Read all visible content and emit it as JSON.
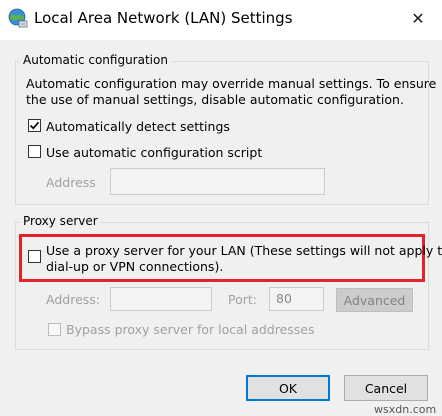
{
  "window": {
    "title": "Local Area Network (LAN) Settings",
    "close_glyph": "✕",
    "icon": "network-globe-icon"
  },
  "auto_config": {
    "legend": "Automatic configuration",
    "desc_line1": "Automatic configuration may override manual settings.  To ensure",
    "desc_line2": "the use of manual settings, disable automatic configuration.",
    "detect_label": "Automatically detect settings",
    "detect_checked": true,
    "script_label": "Use automatic configuration script",
    "script_checked": false,
    "address_label": "Address",
    "address_value": ""
  },
  "proxy": {
    "legend": "Proxy server",
    "use_proxy_line1": "Use a proxy server for your LAN (These settings will not apply to",
    "use_proxy_line2": "dial-up or VPN connections).",
    "use_proxy_checked": false,
    "address_label": "Address:",
    "address_value": "",
    "port_label": "Port:",
    "port_value": "80",
    "advanced_label": "Advanced",
    "bypass_label": "Bypass proxy server for local addresses",
    "bypass_checked": false
  },
  "buttons": {
    "ok": "OK",
    "cancel": "Cancel"
  },
  "watermark": "wsxdn.com",
  "colors": {
    "highlight": "#e3232a",
    "accent": "#0078d7",
    "dialog_bg": "#f0f0f0"
  }
}
